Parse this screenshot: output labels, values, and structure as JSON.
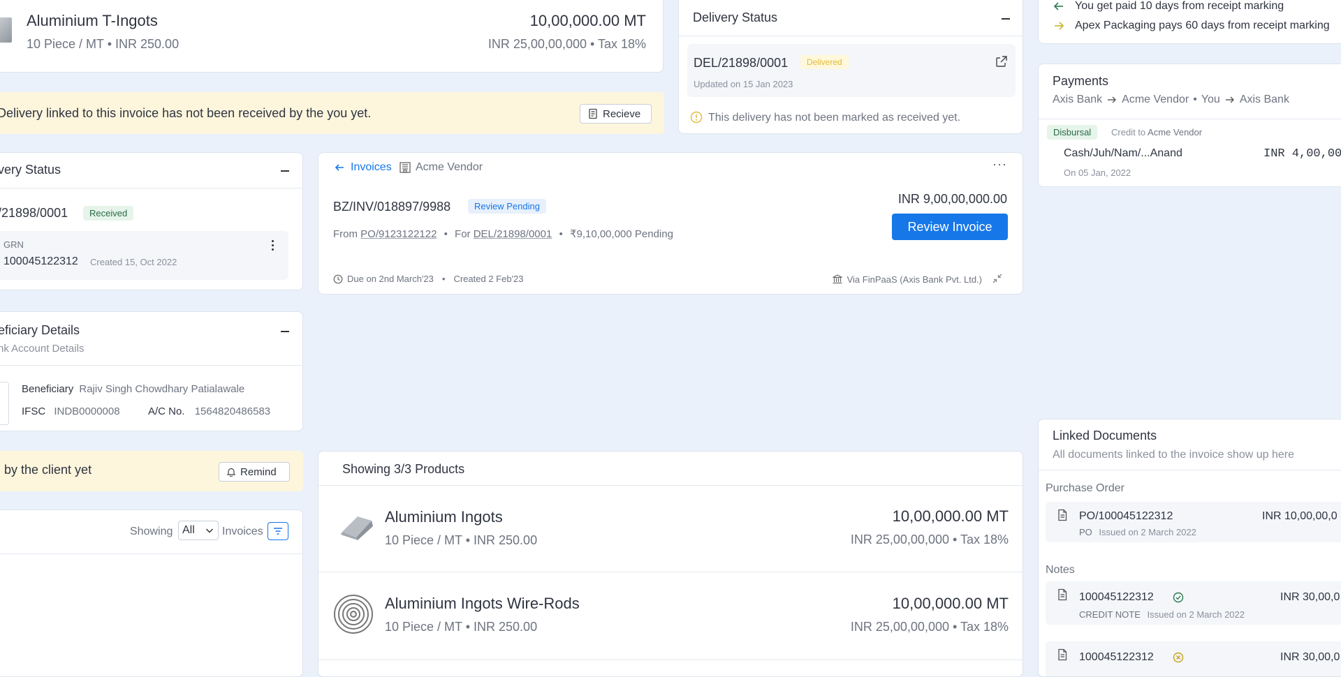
{
  "colors": {
    "accent": "#1677e8",
    "warning_bg": "#fdf6dd",
    "page_bg": "#eaf1fb"
  },
  "top_item": {
    "name": "Aluminium T-Ingots",
    "sub": "10 Piece / MT • INR 250.00",
    "qty": "10,00,000.00 MT",
    "price": "INR 25,00,00,000 • Tax 18%"
  },
  "warning_receive": {
    "text": "Delivery linked to this invoice has not been received by the you yet.",
    "button": "Recieve"
  },
  "delivery_status_top": {
    "title": "Delivery Status",
    "id": "DEL/21898/0001",
    "badge": "Delivered",
    "updated": "Updated on 15 Jan 2023",
    "note": "This delivery has not been marked as received yet."
  },
  "payment_terms": [
    "You get paid 10 days from receipt marking",
    "Apex Packaging pays 60 days from receipt marking"
  ],
  "payments": {
    "title": "Payments",
    "route": {
      "from": "Axis Bank",
      "mid1": "Acme Vendor",
      "mid2": "You",
      "to": "Axis Bank"
    },
    "badge": "Disbursal",
    "credit_label": "Credit to",
    "credit_to": "Acme Vendor",
    "ref": "Cash/Juh/Nam/...Anand",
    "amount": "INR 4,00,00,",
    "date": "On 05 Jan, 2022"
  },
  "delivery_status_left": {
    "title": "very Status",
    "id": "/21898/0001",
    "badge": "Received",
    "grn_label": "GRN",
    "grn_no": "100045122312",
    "grn_created": "Created 15, Oct 2022"
  },
  "invoice": {
    "back": "Invoices",
    "vendor": "Acme Vendor",
    "number": "BZ/INV/018897/9988",
    "status": "Review Pending",
    "amount": "INR 9,00,00,000.00",
    "review_button": "Review Invoice",
    "from_label": "From",
    "po": "PO/9123122122",
    "for_label": "For",
    "del": "DEL/21898/0001",
    "pending": "₹9,10,00,000 Pending",
    "due": "Due on 2nd March'23",
    "created": "Created 2 Feb'23",
    "via": "Via FinPaaS (Axis Bank Pvt. Ltd.)"
  },
  "beneficiary": {
    "title": "eficiary Details",
    "subtitle": "nk Account Details",
    "label": "Beneficiary",
    "name": "Rajiv Singh Chowdhary Patialawale",
    "ifsc_label": "IFSC",
    "ifsc": "INDB0000008",
    "ac_label": "A/C No.",
    "ac": "1564820486583"
  },
  "warning_remind": {
    "text": "by the client yet",
    "button": "Remind"
  },
  "invoices_filter": {
    "showing": "Showing",
    "selected": "All",
    "suffix": "Invoices"
  },
  "products": {
    "title": "Showing 3/3 Products",
    "items": [
      {
        "name": "Aluminium Ingots",
        "sub": "10 Piece / MT • INR 250.00",
        "qty": "10,00,000.00 MT",
        "price": "INR 25,00,00,000 • Tax 18%"
      },
      {
        "name": "Aluminium Ingots Wire-Rods",
        "sub": "10 Piece / MT • INR 250.00",
        "qty": "10,00,000.00 MT",
        "price": "INR 25,00,00,000 • Tax 18%"
      }
    ]
  },
  "linked_docs": {
    "title": "Linked Documents",
    "subtitle": "All documents linked to the invoice show up here",
    "po_section": "Purchase Order",
    "po": {
      "number": "PO/100045122312",
      "type": "PO",
      "issued": "Issued on 2 March 2022",
      "amount": "INR 10,00,00,0"
    },
    "notes_section": "Notes",
    "notes": [
      {
        "number": "100045122312",
        "type": "CREDIT NOTE",
        "issued": "Issued on 2 March 2022",
        "amount": "INR 30,00,0"
      },
      {
        "number": "100045122312",
        "amount": "INR 30,00,0"
      }
    ]
  }
}
